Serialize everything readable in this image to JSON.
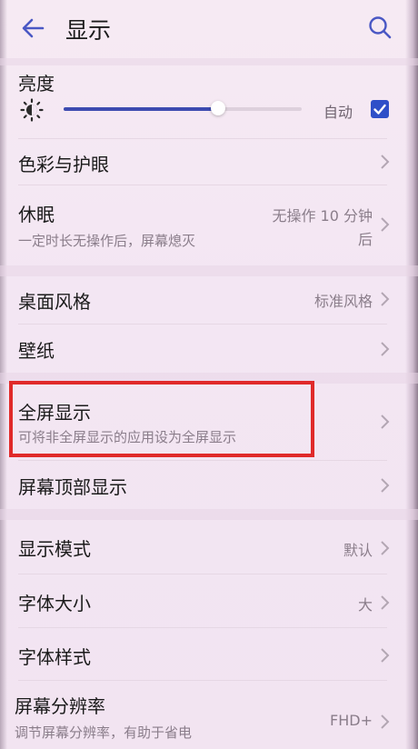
{
  "header": {
    "title": "显示",
    "back_icon": "back-arrow-icon",
    "search_icon": "search-icon",
    "accent_color": "#4a58c4"
  },
  "brightness": {
    "label": "亮度",
    "icon": "brightness-icon",
    "level_fraction": 0.65,
    "auto_label": "自动",
    "auto_checked": true
  },
  "items": {
    "color_eye": {
      "title": "色彩与护眼"
    },
    "sleep": {
      "title": "休眠",
      "subtitle": "一定时长无操作后，屏幕熄灭",
      "value_line1": "无操作 10 分钟",
      "value_line2": "后"
    },
    "desktop_style": {
      "title": "桌面风格",
      "value": "标准风格"
    },
    "wallpaper": {
      "title": "壁纸"
    },
    "fullscreen": {
      "title": "全屏显示",
      "subtitle": "可将非全屏显示的应用设为全屏显示"
    },
    "notch": {
      "title": "屏幕顶部显示"
    },
    "display_mode": {
      "title": "显示模式",
      "value": "默认"
    },
    "font_size": {
      "title": "字体大小",
      "value": "大"
    },
    "font_style": {
      "title": "字体样式"
    },
    "resolution": {
      "title": "屏幕分辨率",
      "subtitle": "调节屏幕分辨率，有助于省电",
      "value": "FHD+"
    }
  },
  "highlight_color": "#e02a2a"
}
